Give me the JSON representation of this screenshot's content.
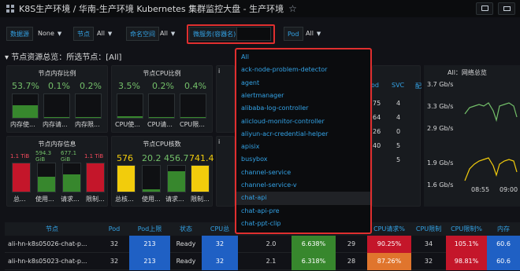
{
  "header": {
    "title": "K8S生产环境 / 华南-生产环境 Kubernetes 集群监控大盘 - 生产环境",
    "star_glyph": "☆"
  },
  "variables": {
    "datasource_label": "数据源",
    "datasource_value": "None",
    "node_label": "节点",
    "node_value": "All",
    "namespace_label": "命名空间",
    "namespace_value": "All",
    "service_label": "微服务(容器名)",
    "service_value": "",
    "pod_label": "Pod",
    "pod_value": "All"
  },
  "section_title": "节点资源总览：所选节点：[All]",
  "panels": {
    "mem_ratio": {
      "title": "节点内存比例",
      "values": [
        "53.7%",
        "0.1%",
        "0.2%"
      ],
      "labels": [
        "内存使...",
        "内存请...",
        "内存限..."
      ]
    },
    "cpu_ratio": {
      "title": "节点CPU比例",
      "values": [
        "3.5%",
        "0.2%",
        "0.4%"
      ],
      "labels": [
        "CPU使...",
        "CPU请...",
        "CPU限..."
      ]
    },
    "mem_info": {
      "title": "节点内存信息",
      "values": [
        "1.1 TiB",
        "594.3 GiB",
        "677.1 GiB",
        "1.1 TiB"
      ],
      "labels": [
        "总...",
        "使用...",
        "请求...",
        "限制..."
      ]
    },
    "cpu_cores": {
      "title": "节点CPU核数",
      "values": [
        "576",
        "20.2",
        "456.7",
        "741.4"
      ],
      "labels": [
        "总核...",
        "使用...",
        "请求...",
        "限制..."
      ]
    },
    "pod_col": {
      "label": "od",
      "values": [
        "75",
        "64",
        "26",
        "40"
      ]
    },
    "svc_col": {
      "label": "SVC",
      "values": [
        "4",
        "4",
        "0",
        "5",
        "5"
      ]
    },
    "side_letters": [
      "i",
      "i",
      "i"
    ],
    "network": {
      "title": "All：网络总览",
      "yticks": [
        "3.7 Gb/s",
        "3.3 Gb/s",
        "2.9 Gb/s",
        "1.9 Gb/s",
        "1.6 Gb/s"
      ],
      "xticks": [
        "08:55",
        "09:00"
      ]
    }
  },
  "table": {
    "headers": [
      "节点",
      "Pod",
      "Pod上限",
      "状态",
      "CPU总",
      "",
      "",
      "",
      "CPU请求%",
      "CPU限制",
      "CPU限制%",
      "内存"
    ],
    "rows": [
      {
        "node": "ali-hn-k8s05026-chat-p...",
        "pod": "32",
        "pod_limit": "213",
        "status": "Ready",
        "cpu_total": "32",
        "c6": "2.0",
        "c7": "6.638%",
        "c8": "29",
        "cpu_req_pct": "90.25%",
        "cpu_limit": "34",
        "cpu_limit_pct": "105.1%",
        "mem": "60.6"
      },
      {
        "node": "ali-hn-k8s05023-chat-p...",
        "pod": "32",
        "pod_limit": "213",
        "status": "Ready",
        "cpu_total": "32",
        "c6": "2.1",
        "c7": "6.318%",
        "c8": "28",
        "cpu_req_pct": "87.26%",
        "cpu_limit": "32",
        "cpu_limit_pct": "98.81%",
        "mem": "60.6"
      }
    ]
  },
  "dropdown": {
    "items": [
      "All",
      "ack-node-problem-detector",
      "agent",
      "alertmanager",
      "alibaba-log-controller",
      "alicloud-monitor-controller",
      "aliyun-acr-credential-helper",
      "apisix",
      "busybox",
      "channel-service",
      "channel-service-v",
      "chat-api",
      "chat-api-pre",
      "chat-ppt-clip"
    ]
  },
  "colors": {
    "accent": "#33a2e5",
    "green": "#73bf69",
    "red": "#f2495c",
    "yellow": "#f2cc0c",
    "highlight_box": "#e02f2f"
  }
}
